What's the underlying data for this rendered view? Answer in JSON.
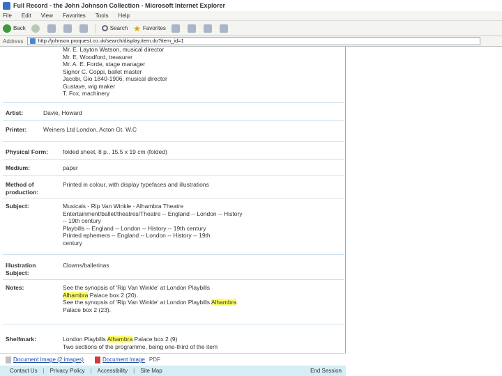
{
  "window": {
    "title": "Full Record - the John Johnson Collection - Microsoft Internet Explorer"
  },
  "menu": [
    "File",
    "Edit",
    "View",
    "Favorites",
    "Tools",
    "Help"
  ],
  "toolbar": {
    "back_label": "Back",
    "search_label": "Search",
    "favorites_label": "Favorites"
  },
  "address": {
    "label": "Address",
    "url": "http://johnson.proquest.co.uk/search/display.item.do?item_id=1"
  },
  "record": {
    "credits": [
      "Mr. E. Layton Watson, musical director",
      "Mr. E. Woodford, treasurer",
      "Mr. A. E. Forde, stage manager",
      "Signor C. Coppi, ballet master",
      "Jacobi, Gio 1840-1906, musical director",
      "Gustave, wig maker",
      "T. Fox, machinery"
    ],
    "artist": {
      "label": "Artist:",
      "value": "Davie, Howard"
    },
    "printer": {
      "label": "Printer:",
      "value": "Weiners Ltd London, Acton Gt. W.C"
    },
    "physical_form": {
      "label": "Physical Form:",
      "value": "folded sheet, 8 p., 15.5 x 19 cm (folded)"
    },
    "medium": {
      "label": "Medium:",
      "value": "paper"
    },
    "method": {
      "label": "Method of production:",
      "value": "Printed in colour, with display typefaces and illustrations"
    },
    "subject": {
      "label": "Subject:",
      "lines": [
        "Musicals - Rip Van Winkle - Alhambra Theatre",
        "Entertainment/ballet/theatres/Theatre -- England -- London -- History",
        "-- 19th century",
        "Playbills -- England -- London -- History -- 19th century",
        "Printed ephemera -- England -- London -- History -- 19th",
        "century"
      ]
    },
    "illustration_subject": {
      "label": "Illustration Subject:",
      "value": "Clowns/ballerinas"
    },
    "notes": {
      "label": "Notes:",
      "line1": "See the synopsis of 'Rip Van Winkle' at London Playbills",
      "line2_hl": "Alhambra",
      "line2_rest": " Palace box 2 (20).",
      "line3_pre": "See the synopsis of 'Rip Van Winkle' at London Playbills ",
      "line3_hl": "Alhambra",
      "line4": "Palace box 2 (23)."
    },
    "shelfmark": {
      "label": "Shelfmark:",
      "line1_pre": "London Playbills ",
      "line1_hl": "Alhambra",
      "line1_post": " Palace box 2 (9)",
      "line2": "Two sections of the programme, being one-third of the item"
    }
  },
  "links": {
    "doc_image_label": "Document Image (2 images)",
    "pdf_label": "Document Image",
    "pdf_suffix": "PDF"
  },
  "footer": {
    "links": [
      "Contact Us",
      "Privacy Policy",
      "Accessibility",
      "Site Map"
    ],
    "end_session": "End Session"
  }
}
